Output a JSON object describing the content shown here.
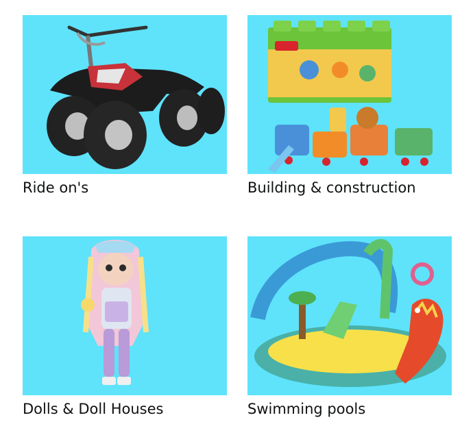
{
  "tiles": [
    {
      "label": "Ride on's",
      "image": "ride-on-quad-bike-image"
    },
    {
      "label": "Building & construction",
      "image": "building-blocks-set-image"
    },
    {
      "label": "Dolls & Doll Houses",
      "image": "fashion-doll-image"
    },
    {
      "label": "Swimming pools",
      "image": "inflatable-dinosaur-pool-image"
    }
  ],
  "colors": {
    "tile_background": "#5ee3fb",
    "label_text": "#0f1111"
  }
}
